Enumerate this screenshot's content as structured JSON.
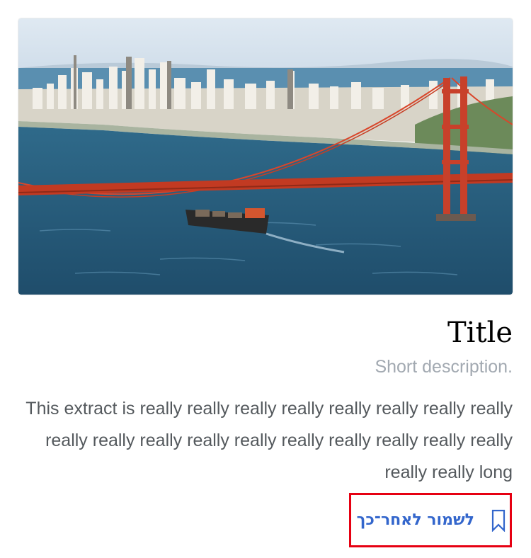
{
  "card": {
    "image_alt": "Golden Gate Bridge with city skyline and cargo ship",
    "title": "Title",
    "description": "Short description.",
    "extract": "This extract is really really really really really really really really really really really really really really really really really really really really long",
    "save_later_label": "לשמור לאחר־כך",
    "bookmark_icon": "bookmark-outline-icon"
  },
  "colors": {
    "link": "#3366cc",
    "description": "#a2a9b1",
    "extract": "#54595d",
    "highlight_border": "#e60012"
  }
}
